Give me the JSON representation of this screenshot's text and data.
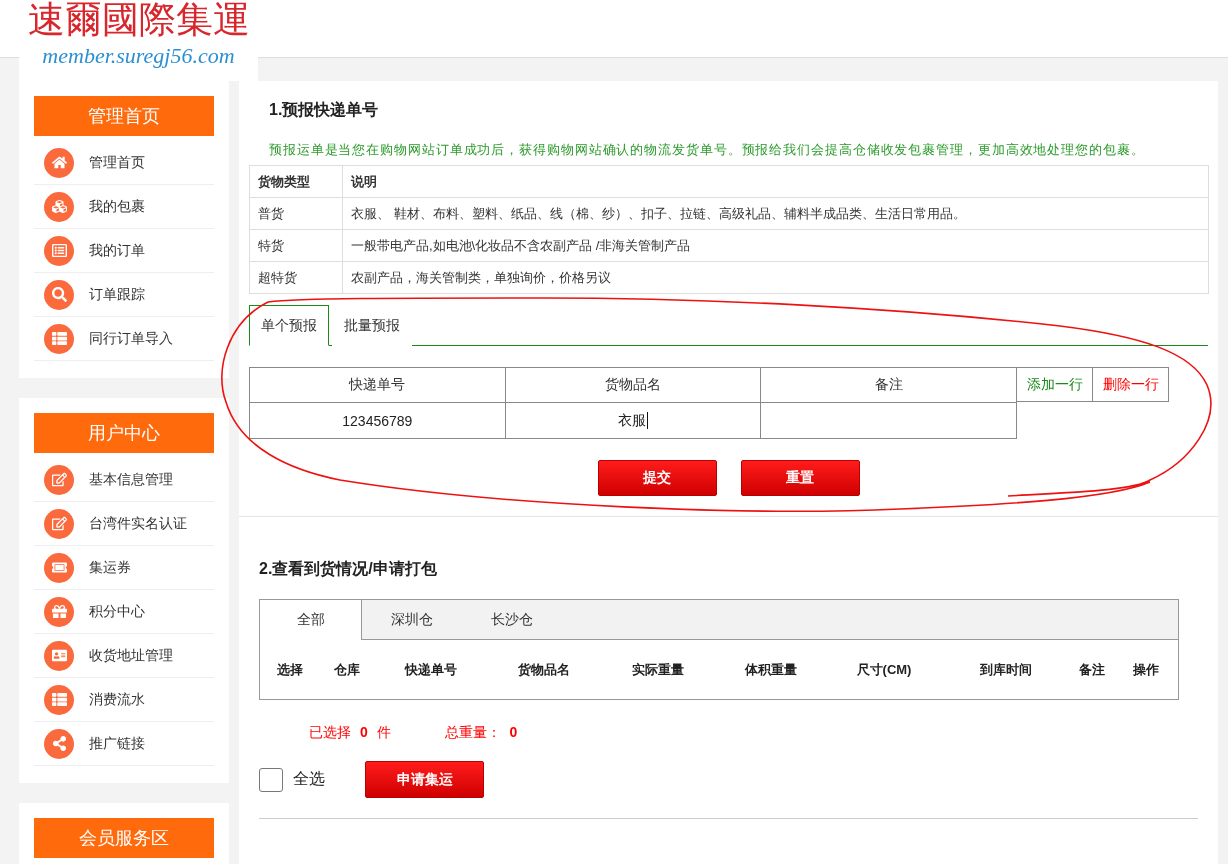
{
  "logo": {
    "name": "速爾國際集運",
    "domain": "member.suregj56.com"
  },
  "sidebar": [
    {
      "title": "管理首页",
      "items": [
        {
          "label": "管理首页"
        },
        {
          "label": "我的包裹"
        },
        {
          "label": "我的订单"
        },
        {
          "label": "订单跟踪"
        },
        {
          "label": "同行订单导入"
        }
      ]
    },
    {
      "title": "用户中心",
      "items": [
        {
          "label": "基本信息管理"
        },
        {
          "label": "台湾件实名认证"
        },
        {
          "label": "集运券"
        },
        {
          "label": "积分中心"
        },
        {
          "label": "收货地址管理"
        },
        {
          "label": "消费流水"
        },
        {
          "label": "推广链接"
        }
      ]
    },
    {
      "title": "会员服务区"
    }
  ],
  "prealert_section": {
    "title": "1.预报快递单号",
    "description": "预报运单是当您在购物网站订单成功后，获得购物网站确认的物流发货单号。预报给我们会提高仓储收发包裹管理，更加高效地处理您的包裹。",
    "cargo_table": {
      "columns": [
        "货物类型",
        "说明"
      ],
      "rows": [
        [
          "普货",
          "衣服、 鞋材、布料、塑料、纸品、线（棉、纱）、扣子、拉链、高级礼品、辅料半成品类、生活日常用品。"
        ],
        [
          "特货",
          "一般带电产品,如电池\\化妆品不含农副产品 /非海关管制产品"
        ],
        [
          "超特货",
          "农副产品，海关管制类，单独询价，价格另议"
        ]
      ]
    },
    "tabs": [
      {
        "label": "单个预报",
        "selected": true
      },
      {
        "label": "批量预报",
        "selected": false
      }
    ],
    "form": {
      "columns": [
        "快递单号",
        "货物品名",
        "备注"
      ],
      "row_actions": [
        {
          "label": "添加一行",
          "kind": "add"
        },
        {
          "label": "删除一行",
          "kind": "delete"
        }
      ],
      "rows": [
        {
          "cells": [
            {
              "value": "123456789",
              "focused": false
            },
            {
              "value": "衣服",
              "focused": true
            },
            {
              "focused": false
            }
          ]
        }
      ]
    },
    "buttons": [
      "提交",
      "重置"
    ]
  },
  "arrivals_section": {
    "title": "2.查看到货情况/申请打包",
    "tabs": [
      {
        "label": "全部",
        "selected": true
      },
      {
        "label": "深圳仓",
        "selected": false
      },
      {
        "label": "长沙仓",
        "selected": false
      }
    ],
    "columns": [
      "选择",
      "仓库",
      "快递单号",
      "货物品名",
      "实际重量",
      "体积重量",
      "尺寸(CM)",
      "到库时间",
      "备注",
      "操作"
    ],
    "summary": {
      "selected": "已选择 **0** 件",
      "total_weight": "总重量： **0**"
    },
    "select_all": {
      "label": "全选",
      "checked": false
    },
    "apply_button": "申请集运"
  }
}
